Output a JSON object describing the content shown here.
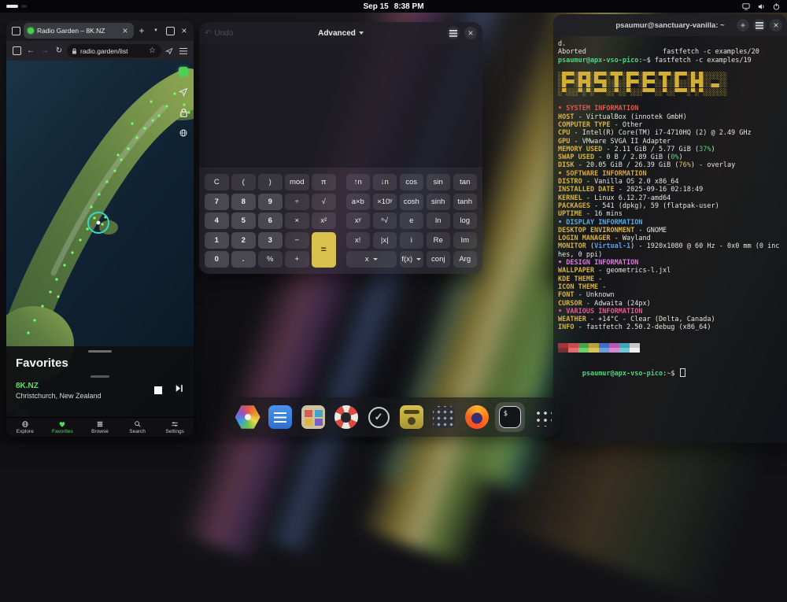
{
  "topbar": {
    "date": "Sep 15",
    "time": "8:38 PM"
  },
  "browser": {
    "tab_title": "Radio Garden – 8K.NZ",
    "url": "radio.garden/list",
    "favorites_title": "Favorites",
    "station_name": "8K.NZ",
    "station_location": "Christchurch, New Zealand",
    "accent_green": "#56d75c",
    "nav_items": [
      {
        "label": "Explore",
        "active": false
      },
      {
        "label": "Favorites",
        "active": true
      },
      {
        "label": "Browse",
        "active": false
      },
      {
        "label": "Search",
        "active": false
      },
      {
        "label": "Settings",
        "active": false
      }
    ]
  },
  "calculator": {
    "undo_label": "Undo",
    "mode_label": "Advanced",
    "display_value": "",
    "equals_color": "#d8c14d",
    "buttons": [
      "C",
      "(",
      ")",
      "mod",
      "π",
      "↑n",
      "↓n",
      "cos",
      "sin",
      "tan",
      "7",
      "8",
      "9",
      "÷",
      "√",
      "a×b",
      "×10ʸ",
      "cosh",
      "sinh",
      "tanh",
      "4",
      "5",
      "6",
      "×",
      "x²",
      "xʸ",
      "ⁿ√",
      "e",
      "ln",
      "log",
      "1",
      "2",
      "3",
      "−",
      "=",
      "x!",
      "|x|",
      "i",
      "Re",
      "Im",
      "0",
      ".",
      "%",
      "+",
      "x",
      "f(x)",
      "conj",
      "Arg"
    ]
  },
  "terminal": {
    "title": "psaumur@sanctuary-vanilla: ~",
    "prompt": {
      "userhost": "psaumur@apx-vso-pico",
      "colon": ":",
      "path": "~",
      "dollar": "$ "
    },
    "palette": [
      [
        "#a8353a",
        "#c94c4c",
        "#4f9e4f",
        "#b9a23c",
        "#3f6fc4",
        "#b559b5",
        "#3fa7b8",
        "#c8c8c8"
      ],
      [
        "#743035",
        "#e06c6c",
        "#6fcf6f",
        "#d8c25a",
        "#6f9fe0",
        "#d08ad0",
        "#6fc8d8",
        "#efefef"
      ]
    ],
    "lines": [
      [
        {
          "t": "d.",
          "c": "w"
        }
      ],
      [
        {
          "t": "Aborted                   fastfetch -c examples/20",
          "c": "w"
        }
      ],
      [
        {
          "t": "psaumur@apx-vso-pico",
          "c": "g"
        },
        {
          "t": ":",
          "c": "w"
        },
        {
          "t": "~",
          "c": "bl"
        },
        {
          "t": "$ ",
          "c": "w"
        },
        {
          "t": "fastfetch -c examples/19",
          "c": "w"
        }
      ],
      [],
      [
        {
          "t": "░█▀▀░█▀█░█▀▀░▀█▀░█▀▀░█▀▀░▀█▀░█▀▀░█░█░░░░░░",
          "c": "art"
        }
      ],
      [
        {
          "t": "░█▀▀░█▀█░▀▀█░░█░░█▀▀░█▀▀░░█░░█░░░█▀█░░▄▄░░",
          "c": "art"
        }
      ],
      [
        {
          "t": "░▀░░░▀░▀░▀▀▀░░▀░░▀░░░▀▀▀░░▀░░▀▀▀░▀░▀░░░░░░",
          "c": "art"
        }
      ],
      [],
      [
        {
          "t": "• ",
          "c": "red"
        },
        {
          "t": "SYSTEM INFORMATION",
          "c": "red"
        }
      ],
      [
        {
          "t": "HOST",
          "c": "y"
        },
        {
          "t": " - VirtualBox (innotek GmbH)",
          "c": "w"
        }
      ],
      [
        {
          "t": "COMPUTER TYPE",
          "c": "y"
        },
        {
          "t": " - Other",
          "c": "w"
        }
      ],
      [
        {
          "t": "CPU",
          "c": "y"
        },
        {
          "t": " - Intel(R) Core(TM) i7-4710HQ (2) @ 2.49 GHz",
          "c": "w"
        }
      ],
      [
        {
          "t": "GPU",
          "c": "y"
        },
        {
          "t": " - VMware SVGA II Adapter",
          "c": "w"
        }
      ],
      [
        {
          "t": "MEMORY USED",
          "c": "y"
        },
        {
          "t": " - 2.11 GiB / 5.77 GiB (",
          "c": "w"
        },
        {
          "t": "37%",
          "c": "grn"
        },
        {
          "t": ")",
          "c": "w"
        }
      ],
      [
        {
          "t": "SWAP USED",
          "c": "y"
        },
        {
          "t": " - 0 B / 2.89 GiB (",
          "c": "w"
        },
        {
          "t": "0%",
          "c": "grn"
        },
        {
          "t": ")",
          "c": "w"
        }
      ],
      [
        {
          "t": "DISK",
          "c": "y"
        },
        {
          "t": " - 20.05 GiB / 26.39 GiB (",
          "c": "w"
        },
        {
          "t": "76%",
          "c": "ylw"
        },
        {
          "t": ") - overlay",
          "c": "w"
        }
      ],
      [
        {
          "t": "• ",
          "c": "org"
        },
        {
          "t": "SOFTWARE INFORMATION",
          "c": "org"
        }
      ],
      [
        {
          "t": "DISTRO",
          "c": "y"
        },
        {
          "t": " - Vanilla OS 2.0 x86_64",
          "c": "w"
        }
      ],
      [
        {
          "t": "INSTALLED DATE",
          "c": "y"
        },
        {
          "t": " - 2025-09-16 02:18:49",
          "c": "w"
        }
      ],
      [
        {
          "t": "KERNEL",
          "c": "y"
        },
        {
          "t": " - Linux 6.12.27-amd64",
          "c": "w"
        }
      ],
      [
        {
          "t": "PACKAGES",
          "c": "y"
        },
        {
          "t": " - 541 (dpkg), 59 (flatpak-user)",
          "c": "w"
        }
      ],
      [
        {
          "t": "UPTIME",
          "c": "y"
        },
        {
          "t": " - 16 mins",
          "c": "w"
        }
      ],
      [
        {
          "t": "• ",
          "c": "cyn"
        },
        {
          "t": "DISPLAY INFORMATION",
          "c": "cyn"
        }
      ],
      [
        {
          "t": "DESKTOP ENVIRONMENT",
          "c": "y"
        },
        {
          "t": " - GNOME",
          "c": "w"
        }
      ],
      [
        {
          "t": "LOGIN MANAGER",
          "c": "y"
        },
        {
          "t": " - Wayland",
          "c": "w"
        }
      ],
      [
        {
          "t": "MONITOR",
          "c": "y"
        },
        {
          "t": " (",
          "c": "w"
        },
        {
          "t": "Virtual-1",
          "c": "bl"
        },
        {
          "t": ") - 1920x1080 @ 60 Hz - 0x0 mm (0 inches, 0 ppi)",
          "c": "w"
        }
      ],
      [
        {
          "t": "• ",
          "c": "pnk"
        },
        {
          "t": "DESIGN INFORMATION",
          "c": "pnk"
        }
      ],
      [
        {
          "t": "WALLPAPER",
          "c": "y"
        },
        {
          "t": " - geometrics-l.jxl",
          "c": "w"
        }
      ],
      [
        {
          "t": "KDE THEME",
          "c": "y"
        },
        {
          "t": " - ",
          "c": "w"
        }
      ],
      [
        {
          "t": "ICON THEME",
          "c": "y"
        },
        {
          "t": " - ",
          "c": "w"
        }
      ],
      [
        {
          "t": "FONT",
          "c": "y"
        },
        {
          "t": " - Unknown",
          "c": "w"
        }
      ],
      [
        {
          "t": "CURSOR",
          "c": "y"
        },
        {
          "t": " - Adwaita (24px)",
          "c": "w"
        }
      ],
      [
        {
          "t": "• ",
          "c": "mag"
        },
        {
          "t": "VARIOUS INFORMATION",
          "c": "mag"
        }
      ],
      [
        {
          "t": "WEATHER",
          "c": "y"
        },
        {
          "t": " - +14°C - Clear (Delta, Canada)",
          "c": "w"
        }
      ],
      [
        {
          "t": "INFO",
          "c": "y"
        },
        {
          "t": " - fastfetch 2.50.2-debug (x86_64)",
          "c": "w"
        }
      ],
      []
    ]
  },
  "dock": {
    "items": [
      "software-store",
      "docs-blue",
      "photo-library",
      "help",
      "updates",
      "radio",
      "app-tiles",
      "firefox",
      "terminal",
      "app-grid"
    ]
  }
}
